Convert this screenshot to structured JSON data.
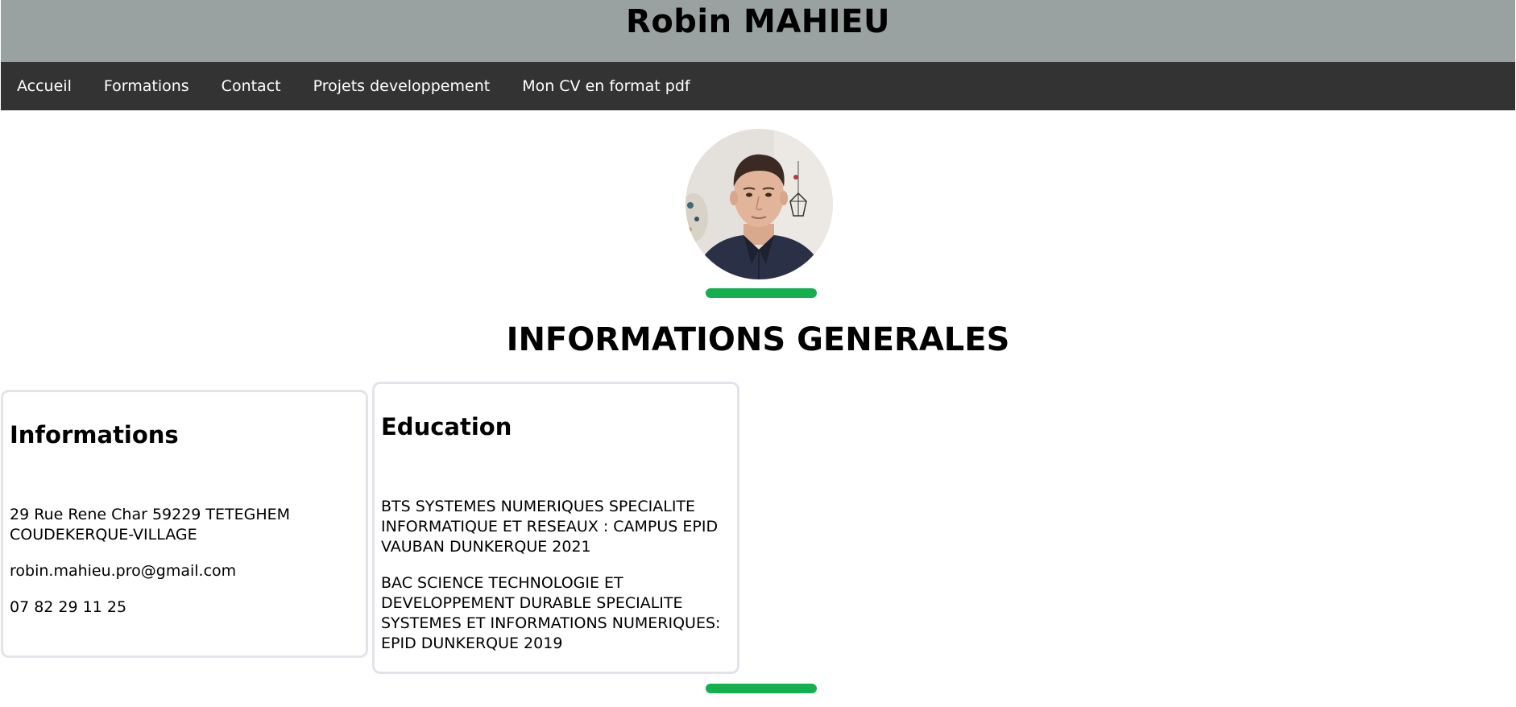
{
  "header": {
    "title": "Robin MAHIEU"
  },
  "nav": {
    "items": [
      {
        "label": "Accueil"
      },
      {
        "label": "Formations"
      },
      {
        "label": "Contact"
      },
      {
        "label": "Projets developpement"
      },
      {
        "label": "Mon CV en format pdf"
      }
    ]
  },
  "main": {
    "section_title": "INFORMATIONS GENERALES",
    "info_card": {
      "title": "Informations",
      "address": "29 Rue Rene Char 59229 TETEGHEM COUDEKERQUE-VILLAGE",
      "email": "robin.mahieu.pro@gmail.com",
      "phone": "07 82 29 11 25"
    },
    "education_card": {
      "title": "Education",
      "entries": [
        {
          "text": "BTS SYSTEMES NUMERIQUES SPECIALITE INFORMATIQUE ET RESEAUX : CAMPUS EPID VAUBAN DUNKERQUE 2021"
        },
        {
          "text": "BAC SCIENCE TECHNOLOGIE ET DEVELOPPEMENT DURABLE SPECIALITE SYSTEMES ET INFORMATIONS NUMERIQUES: EPID DUNKERQUE 2019"
        }
      ]
    }
  },
  "colors": {
    "header_bg": "#99a1a1",
    "nav_bg": "#333333",
    "accent_green": "#13b04f",
    "card_border": "#e3e3ea"
  }
}
